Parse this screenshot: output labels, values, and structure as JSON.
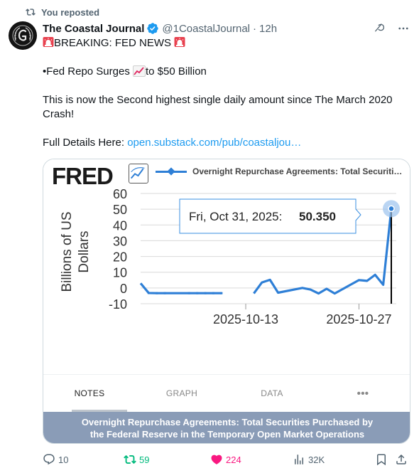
{
  "social_context": {
    "label": "You reposted",
    "icon": "repost-icon"
  },
  "author": {
    "name": "The Coastal Journal",
    "handle": "@1CoastalJournal",
    "separator": "·",
    "time": "12h",
    "verified": true
  },
  "tweet": {
    "line1": "BREAKING: FED NEWS",
    "line2_prefix": "•Fed Repo Surges",
    "line2_suffix": "to $50 Billion",
    "line3": "This is now the Second highest single daily amount since The March 2020 Crash!",
    "line4_prefix": "Full Details Here:",
    "link_text": "open.substack.com/pub/coastaljou…"
  },
  "card": {
    "logo": "FRED",
    "legend_label": "Overnight Repurchase Agreements: Total Securiti…",
    "tooltip_date": "Fri, Oct 31, 2025:",
    "tooltip_value": "50.350",
    "tabs": [
      "NOTES",
      "GRAPH",
      "DATA",
      "•••"
    ],
    "active_tab": "NOTES",
    "caption_line1": "Overnight Repurchase Agreements: Total Securities Purchased by",
    "caption_line2": "the Federal Reserve in the Temporary Open Market Operations"
  },
  "chart_data": {
    "type": "line",
    "title": "",
    "xlabel": "",
    "ylabel": "Billions of US Dollars",
    "ylim": [
      -10,
      60
    ],
    "yticks": [
      60,
      50,
      40,
      30,
      20,
      10,
      0,
      -10
    ],
    "xticks": [
      "2025-10-13",
      "2025-10-27"
    ],
    "series": [
      {
        "name": "Overnight Repurchase Agreements: Total Securiti…",
        "color": "#2e7fd6",
        "segments": [
          {
            "x": [
              "2025-09-30",
              "2025-10-01",
              "2025-10-02",
              "2025-10-03",
              "2025-10-06",
              "2025-10-07",
              "2025-10-08",
              "2025-10-09",
              "2025-10-10"
            ],
            "y": [
              3,
              -3.2,
              -3.3,
              -3.3,
              -3.3,
              -3.3,
              -3.3,
              -3.3,
              -3.3
            ]
          },
          {
            "x": [
              "2025-10-14",
              "2025-10-15",
              "2025-10-16",
              "2025-10-17",
              "2025-10-20",
              "2025-10-21",
              "2025-10-22",
              "2025-10-23",
              "2025-10-24",
              "2025-10-27",
              "2025-10-28",
              "2025-10-29",
              "2025-10-30",
              "2025-10-31"
            ],
            "y": [
              -3.5,
              3.5,
              5.2,
              -3.0,
              0,
              -1.0,
              -3.5,
              -0.5,
              -3.5,
              5.0,
              4.5,
              8.35,
              2.0,
              50.35
            ]
          }
        ]
      }
    ]
  },
  "actions": {
    "replies": "10",
    "reposts": "59",
    "likes": "224",
    "views": "32K"
  },
  "colors": {
    "link": "#1d9bf0",
    "series": "#2e7fd6",
    "repost_active": "#00ba7c",
    "like_active": "#f91880",
    "caption_bg": "#8a9cb7"
  }
}
